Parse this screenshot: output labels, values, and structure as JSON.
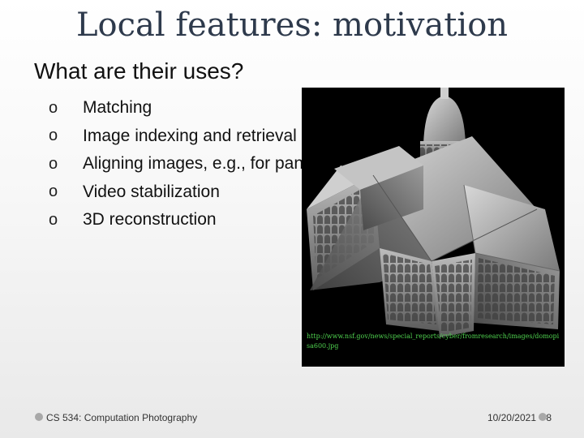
{
  "slide": {
    "title": "Local features: motivation",
    "subtitle": "What are their uses?",
    "bullet_marker": "o",
    "bullets": [
      "Matching",
      "Image indexing and retrieval",
      "Aligning images, e.g., for panoramas",
      "Video stabilization",
      "3D reconstruction"
    ]
  },
  "image": {
    "credit": "http://www.nsf.gov/news/special_reports/cyber/fromresearch/images/domopisa600.jpg"
  },
  "footer": {
    "course": "CS 534: Computation Photography",
    "date": "10/20/2021",
    "page": "8"
  },
  "colors": {
    "title": "#2e3a4c",
    "credit": "#4fd14f",
    "footer_dot": "#a8a8a8"
  }
}
